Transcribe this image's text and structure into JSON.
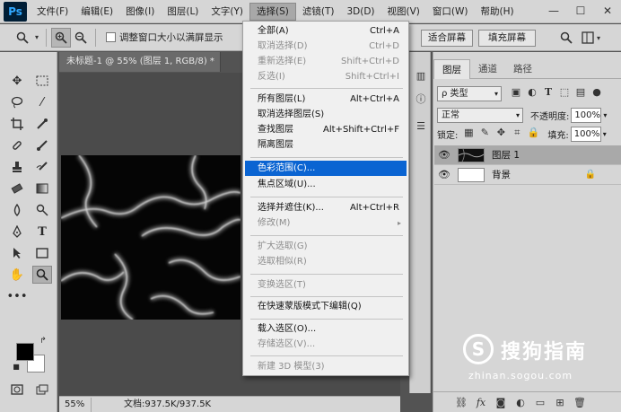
{
  "app": {
    "logo": "Ps"
  },
  "menubar": {
    "items": [
      "文件(F)",
      "编辑(E)",
      "图像(I)",
      "图层(L)",
      "文字(Y)",
      "选择(S)",
      "滤镜(T)",
      "3D(D)",
      "视图(V)",
      "窗口(W)",
      "帮助(H)"
    ],
    "active": "选择(S)",
    "window_buttons": [
      "—",
      "☐",
      "✕"
    ]
  },
  "options": {
    "resize_window_label": "调整窗口大小以满屏显示",
    "fit_screen_label": "适合屏幕",
    "fill_screen_label": "填充屏幕"
  },
  "document": {
    "tab_title": "未标题-1 @ 55% (图层 1, RGB/8) *",
    "tab_close": "×",
    "zoom": "55%",
    "doc_size": "文档:937.5K/937.5K"
  },
  "select_menu": {
    "groups": [
      [
        {
          "label": "全部(A)",
          "shortcut": "Ctrl+A",
          "enabled": true
        },
        {
          "label": "取消选择(D)",
          "shortcut": "Ctrl+D",
          "enabled": false
        },
        {
          "label": "重新选择(E)",
          "shortcut": "Shift+Ctrl+D",
          "enabled": false
        },
        {
          "label": "反选(I)",
          "shortcut": "Shift+Ctrl+I",
          "enabled": false
        }
      ],
      [
        {
          "label": "所有图层(L)",
          "shortcut": "Alt+Ctrl+A",
          "enabled": true
        },
        {
          "label": "取消选择图层(S)",
          "shortcut": "",
          "enabled": true
        },
        {
          "label": "查找图层",
          "shortcut": "Alt+Shift+Ctrl+F",
          "enabled": true
        },
        {
          "label": "隔离图层",
          "shortcut": "",
          "enabled": true
        }
      ],
      [
        {
          "label": "色彩范围(C)...",
          "shortcut": "",
          "enabled": true,
          "highlighted": true
        },
        {
          "label": "焦点区域(U)...",
          "shortcut": "",
          "enabled": true
        }
      ],
      [
        {
          "label": "选择并遮住(K)...",
          "shortcut": "Alt+Ctrl+R",
          "enabled": true
        },
        {
          "label": "修改(M)",
          "shortcut": "",
          "enabled": false,
          "submenu": true
        }
      ],
      [
        {
          "label": "扩大选取(G)",
          "shortcut": "",
          "enabled": false
        },
        {
          "label": "选取相似(R)",
          "shortcut": "",
          "enabled": false
        }
      ],
      [
        {
          "label": "变换选区(T)",
          "shortcut": "",
          "enabled": false
        }
      ],
      [
        {
          "label": "在快速蒙版模式下编辑(Q)",
          "shortcut": "",
          "enabled": true
        }
      ],
      [
        {
          "label": "载入选区(O)...",
          "shortcut": "",
          "enabled": true
        },
        {
          "label": "存储选区(V)...",
          "shortcut": "",
          "enabled": false
        }
      ],
      [
        {
          "label": "新建 3D 模型(3)",
          "shortcut": "",
          "enabled": false
        }
      ]
    ],
    "submenu_arrow": "▸"
  },
  "layers_panel": {
    "tabs": [
      "图层",
      "通道",
      "路径"
    ],
    "active_tab": "图层",
    "filter_label": "ρ 类型",
    "blend_mode": "正常",
    "opacity_label": "不透明度:",
    "opacity_value": "100%",
    "lock_label": "锁定:",
    "fill_label": "填充:",
    "fill_value": "100%",
    "layers": [
      {
        "name": "图层 1",
        "selected": true,
        "visible": true,
        "locked": false
      },
      {
        "name": "背景",
        "selected": false,
        "visible": true,
        "locked": true
      }
    ]
  },
  "watermark": {
    "text": "搜狗指南",
    "url": "zhinan.sogou.com"
  },
  "colors": {
    "highlight": "#0a64d2",
    "foreground": "#000000",
    "background": "#ffffff"
  }
}
